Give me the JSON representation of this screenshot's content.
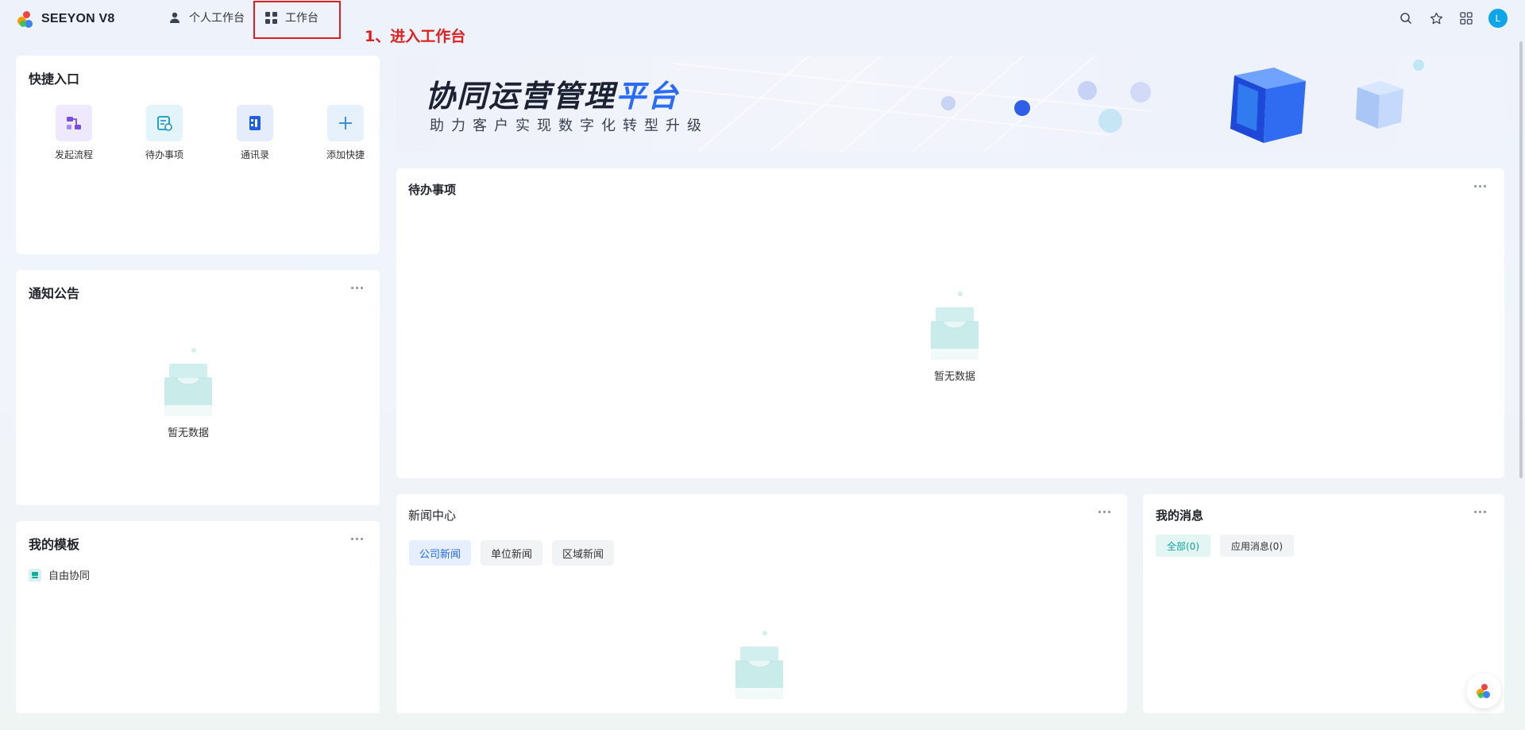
{
  "app": {
    "name": "SEEYON V8"
  },
  "nav": {
    "personal_label": "个人工作台",
    "workbench_label": "工作台"
  },
  "annotation": {
    "text": "1、进入工作台",
    "color": "#e02020"
  },
  "user": {
    "avatar_letter": "L"
  },
  "quick": {
    "title": "快捷入口",
    "items": [
      {
        "label": "发起流程",
        "icon": "flow-icon"
      },
      {
        "label": "待办事项",
        "icon": "todo-icon"
      },
      {
        "label": "通讯录",
        "icon": "contacts-icon"
      },
      {
        "label": "添加快捷",
        "icon": "plus-icon"
      }
    ]
  },
  "notice": {
    "title": "通知公告",
    "empty": "暂无数据"
  },
  "templates": {
    "title": "我的模板",
    "items": [
      {
        "label": "自由协同"
      }
    ]
  },
  "banner": {
    "title_main": "协同运营管理",
    "title_accent": "平台",
    "subtitle": "助力客户实现数字化转型升级"
  },
  "todo": {
    "title": "待办事项",
    "empty": "暂无数据"
  },
  "news": {
    "title": "新闻中心",
    "tabs": [
      "公司新闻",
      "单位新闻",
      "区域新闻"
    ],
    "active_tab": 0
  },
  "messages": {
    "title": "我的消息",
    "tabs": [
      "全部(0)",
      "应用消息(0)"
    ],
    "active_tab": 0
  },
  "colors": {
    "accent_blue": "#2468f2",
    "accent_teal": "#10a39a"
  }
}
